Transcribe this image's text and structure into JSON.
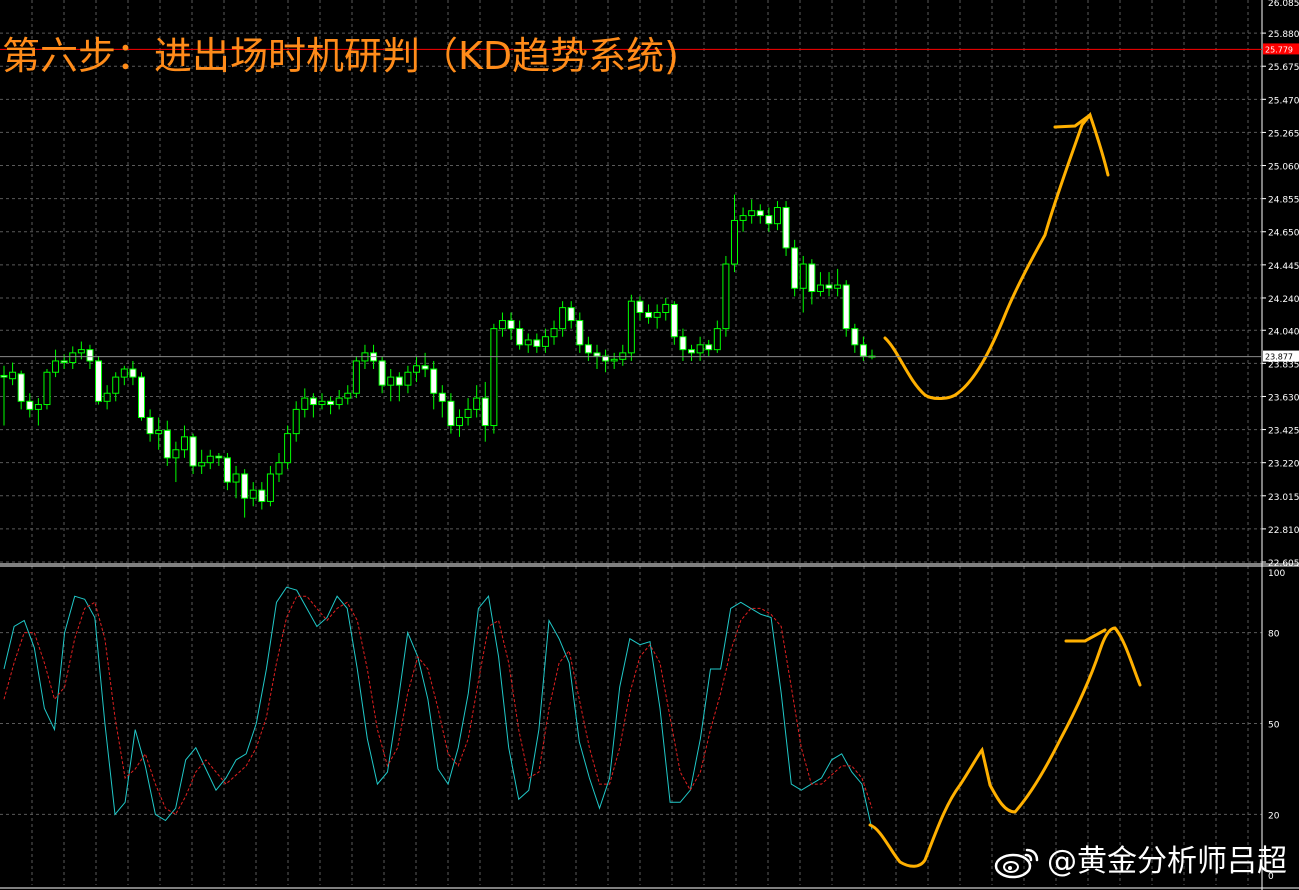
{
  "title": "第六步：进出场时机研判（KD趋势系统)",
  "watermark": "@黄金分析师吕超",
  "watermark_icon": "weibo-logo-icon",
  "colors": {
    "background": "#000000",
    "grid": "#5a5a5a",
    "axis": "#ffffff",
    "bull_candle": "#00ff00",
    "bear_candle_body": "#ffffff",
    "k_line": "#20c8c8",
    "d_line": "#e02020",
    "hand_drawn": "#ffb000",
    "red_level": "#ff0000",
    "title": "#ff8c1a"
  },
  "chart_data": [
    {
      "type": "candlestick",
      "name": "price",
      "yticks": [
        "25.880",
        "25.675",
        "25.470",
        "25.265",
        "25.060",
        "24.855",
        "24.650",
        "24.445",
        "24.240",
        "24.040",
        "23.835",
        "23.630",
        "23.425",
        "23.220",
        "23.015",
        "22.810",
        "22.605"
      ],
      "ylim": [
        22.605,
        26.085
      ],
      "top_partial_tick": "26.085",
      "current_price": "23.877",
      "red_level": "25.779",
      "grid": true,
      "candles": [
        [
          23.76,
          23.75,
          23.82,
          23.45
        ],
        [
          23.74,
          23.78,
          23.84,
          23.7
        ],
        [
          23.77,
          23.6,
          23.79,
          23.55
        ],
        [
          23.6,
          23.55,
          23.65,
          23.5
        ],
        [
          23.55,
          23.58,
          23.62,
          23.45
        ],
        [
          23.58,
          23.78,
          23.8,
          23.55
        ],
        [
          23.78,
          23.85,
          23.92,
          23.75
        ],
        [
          23.85,
          23.84,
          23.89,
          23.8
        ],
        [
          23.84,
          23.9,
          23.94,
          23.8
        ],
        [
          23.9,
          23.92,
          23.97,
          23.86
        ],
        [
          23.92,
          23.85,
          23.95,
          23.8
        ],
        [
          23.85,
          23.6,
          23.88,
          23.58
        ],
        [
          23.6,
          23.65,
          23.7,
          23.55
        ],
        [
          23.65,
          23.75,
          23.78,
          23.6
        ],
        [
          23.75,
          23.8,
          23.82,
          23.7
        ],
        [
          23.8,
          23.75,
          23.85,
          23.7
        ],
        [
          23.75,
          23.5,
          23.78,
          23.48
        ],
        [
          23.5,
          23.4,
          23.55,
          23.35
        ],
        [
          23.4,
          23.42,
          23.5,
          23.3
        ],
        [
          23.42,
          23.25,
          23.48,
          23.2
        ],
        [
          23.25,
          23.3,
          23.35,
          23.1
        ],
        [
          23.3,
          23.38,
          23.45,
          23.25
        ],
        [
          23.38,
          23.2,
          23.4,
          23.15
        ],
        [
          23.2,
          23.22,
          23.3,
          23.15
        ],
        [
          23.22,
          23.26,
          23.3,
          23.18
        ],
        [
          23.26,
          23.25,
          23.28,
          23.2
        ],
        [
          23.25,
          23.1,
          23.28,
          23.05
        ],
        [
          23.1,
          23.15,
          23.2,
          23.0
        ],
        [
          23.15,
          23.0,
          23.18,
          22.88
        ],
        [
          23.0,
          23.05,
          23.1,
          22.95
        ],
        [
          23.05,
          22.98,
          23.1,
          22.93
        ],
        [
          22.98,
          23.15,
          23.2,
          22.95
        ],
        [
          23.15,
          23.22,
          23.28,
          23.1
        ],
        [
          23.22,
          23.4,
          23.45,
          23.18
        ],
        [
          23.4,
          23.55,
          23.6,
          23.35
        ],
        [
          23.55,
          23.62,
          23.68,
          23.5
        ],
        [
          23.62,
          23.58,
          23.65,
          23.5
        ],
        [
          23.58,
          23.6,
          23.65,
          23.55
        ],
        [
          23.6,
          23.58,
          23.63,
          23.52
        ],
        [
          23.58,
          23.62,
          23.67,
          23.55
        ],
        [
          23.62,
          23.65,
          23.7,
          23.58
        ],
        [
          23.65,
          23.85,
          23.88,
          23.62
        ],
        [
          23.85,
          23.9,
          23.95,
          23.8
        ],
        [
          23.9,
          23.85,
          23.95,
          23.8
        ],
        [
          23.85,
          23.7,
          23.88,
          23.65
        ],
        [
          23.7,
          23.75,
          23.8,
          23.6
        ],
        [
          23.75,
          23.7,
          23.78,
          23.6
        ],
        [
          23.7,
          23.78,
          23.82,
          23.65
        ],
        [
          23.78,
          23.82,
          23.88,
          23.72
        ],
        [
          23.82,
          23.8,
          23.9,
          23.75
        ],
        [
          23.8,
          23.65,
          23.85,
          23.55
        ],
        [
          23.65,
          23.6,
          23.7,
          23.5
        ],
        [
          23.6,
          23.45,
          23.65,
          23.4
        ],
        [
          23.45,
          23.5,
          23.55,
          23.38
        ],
        [
          23.5,
          23.55,
          23.62,
          23.45
        ],
        [
          23.55,
          23.62,
          23.7,
          23.5
        ],
        [
          23.62,
          23.45,
          23.72,
          23.35
        ],
        [
          23.45,
          24.05,
          24.08,
          23.4
        ],
        [
          24.05,
          24.1,
          24.15,
          24.0
        ],
        [
          24.1,
          24.05,
          24.15,
          23.98
        ],
        [
          24.05,
          23.95,
          24.1,
          23.92
        ],
        [
          23.95,
          23.98,
          24.02,
          23.9
        ],
        [
          23.98,
          23.94,
          24.02,
          23.9
        ],
        [
          23.94,
          24.0,
          24.05,
          23.9
        ],
        [
          24.0,
          24.05,
          24.1,
          23.95
        ],
        [
          24.05,
          24.18,
          24.22,
          24.0
        ],
        [
          24.18,
          24.1,
          24.22,
          24.05
        ],
        [
          24.1,
          23.95,
          24.15,
          23.9
        ],
        [
          23.95,
          23.9,
          24.0,
          23.85
        ],
        [
          23.9,
          23.88,
          23.95,
          23.8
        ],
        [
          23.88,
          23.85,
          23.92,
          23.78
        ],
        [
          23.85,
          23.86,
          23.9,
          23.8
        ],
        [
          23.86,
          23.9,
          23.95,
          23.82
        ],
        [
          23.9,
          24.22,
          24.26,
          23.85
        ],
        [
          24.22,
          24.15,
          24.25,
          24.1
        ],
        [
          24.15,
          24.12,
          24.2,
          24.08
        ],
        [
          24.12,
          24.15,
          24.2,
          24.05
        ],
        [
          24.15,
          24.2,
          24.24,
          24.1
        ],
        [
          24.2,
          24.0,
          24.22,
          23.95
        ],
        [
          24.0,
          23.92,
          24.05,
          23.85
        ],
        [
          23.92,
          23.9,
          23.95,
          23.85
        ],
        [
          23.9,
          23.95,
          24.0,
          23.85
        ],
        [
          23.95,
          23.92,
          23.98,
          23.88
        ],
        [
          23.92,
          24.05,
          24.1,
          23.9
        ],
        [
          24.05,
          24.45,
          24.5,
          24.0
        ],
        [
          24.45,
          24.72,
          24.88,
          24.4
        ],
        [
          24.72,
          24.75,
          24.8,
          24.65
        ],
        [
          24.75,
          24.78,
          24.85,
          24.7
        ],
        [
          24.78,
          24.75,
          24.82,
          24.7
        ],
        [
          24.75,
          24.7,
          24.8,
          24.65
        ],
        [
          24.7,
          24.8,
          24.84,
          24.66
        ],
        [
          24.8,
          24.55,
          24.84,
          24.5
        ],
        [
          24.55,
          24.3,
          24.6,
          24.25
        ],
        [
          24.3,
          24.45,
          24.5,
          24.15
        ],
        [
          24.45,
          24.28,
          24.48,
          24.2
        ],
        [
          24.28,
          24.32,
          24.4,
          24.25
        ],
        [
          24.32,
          24.3,
          24.4,
          24.25
        ],
        [
          24.3,
          24.32,
          24.42,
          24.25
        ],
        [
          24.32,
          24.05,
          24.35,
          24.0
        ],
        [
          24.05,
          23.95,
          24.08,
          23.9
        ],
        [
          23.95,
          23.88,
          24.0,
          23.85
        ],
        [
          23.88,
          23.88,
          23.92,
          23.86
        ]
      ]
    },
    {
      "type": "line",
      "name": "stochastic",
      "yticks": [
        "100",
        "80",
        "50",
        "20",
        "0"
      ],
      "ylim": [
        0,
        100
      ],
      "grid": true,
      "series": [
        {
          "values": [
            68,
            82,
            84,
            75,
            55,
            48,
            80,
            92,
            91,
            85,
            50,
            20,
            24,
            48,
            36,
            20,
            18,
            22,
            38,
            42,
            35,
            28,
            32,
            38,
            40,
            50,
            68,
            90,
            95,
            94,
            88,
            82,
            85,
            92,
            88,
            68,
            45,
            30,
            34,
            56,
            80,
            72,
            58,
            35,
            30,
            42,
            60,
            88,
            92,
            72,
            42,
            25,
            28,
            48,
            84,
            78,
            70,
            44,
            32,
            22,
            32,
            62,
            78,
            76,
            77,
            55,
            24,
            24,
            28,
            45,
            68,
            68,
            88,
            90,
            88,
            86,
            85,
            60,
            30,
            28,
            30,
            32,
            38,
            40,
            34,
            30,
            15
          ]
        },
        {
          "values": [
            58,
            70,
            80,
            80,
            70,
            58,
            62,
            78,
            88,
            90,
            78,
            52,
            32,
            35,
            40,
            30,
            22,
            20,
            26,
            34,
            38,
            34,
            30,
            33,
            36,
            42,
            52,
            70,
            85,
            92,
            92,
            88,
            84,
            88,
            90,
            84,
            68,
            48,
            36,
            42,
            60,
            72,
            68,
            55,
            40,
            36,
            45,
            64,
            82,
            84,
            70,
            48,
            32,
            34,
            55,
            70,
            74,
            58,
            42,
            30,
            30,
            42,
            60,
            72,
            76,
            70,
            52,
            34,
            28,
            34,
            48,
            60,
            74,
            84,
            88,
            88,
            86,
            82,
            62,
            42,
            30,
            30,
            33,
            36,
            36,
            32,
            22
          ]
        }
      ]
    }
  ]
}
